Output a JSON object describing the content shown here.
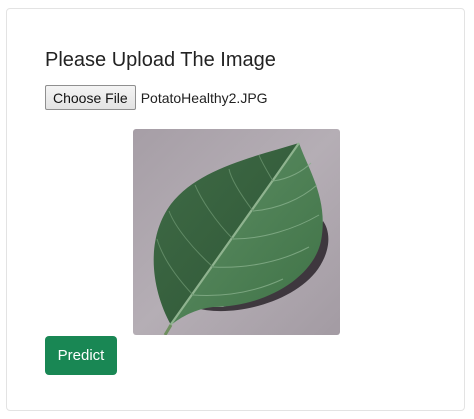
{
  "upload_form": {
    "heading": "Please Upload The Image",
    "file_input": {
      "button_label": "Choose File",
      "selected_file": "PotatoHealthy2.JPG"
    },
    "preview_image": {
      "subject": "potato leaf"
    },
    "predict_button": {
      "label": "Predict",
      "color": "#198754"
    }
  }
}
